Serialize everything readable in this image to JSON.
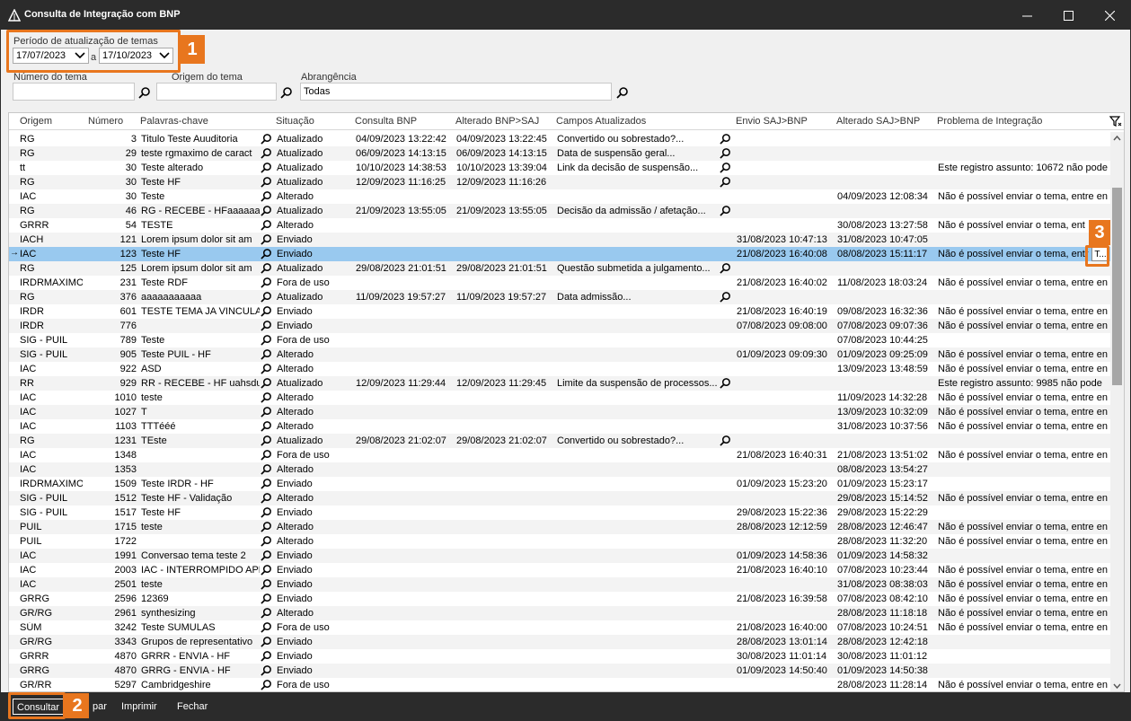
{
  "window": {
    "title": "Consulta de Integração com BNP"
  },
  "filters": {
    "period_label": "Período de atualização de temas",
    "date_from": "17/07/2023",
    "date_sep": "a",
    "date_to": "17/10/2023",
    "numero_label": "Número do tema",
    "numero_value": "",
    "origem_label": "Origem do tema",
    "origem_value": "",
    "abrangencia_label": "Abrangência",
    "abrangencia_value": "Todas"
  },
  "callouts": {
    "c1": "1",
    "c2": "2",
    "c3": "3"
  },
  "grid": {
    "columns": [
      "Origem",
      "Número",
      "Palavras-chave",
      "Situação",
      "Consulta BNP",
      "Alterado BNP>SAJ",
      "Campos Atualizados",
      "Envio SAJ>BNP",
      "Alterado SAJ>BNP",
      "Problema de Integração"
    ],
    "ellipsis_label": "T...",
    "rows": [
      {
        "o": "RG",
        "n": "3",
        "p": "Titulo Teste Auuditoria",
        "s": "Atualizado",
        "c": "04/09/2023 13:22:42",
        "a": "04/09/2023 13:22:45",
        "f": "Convertido ou sobrestado?...",
        "e": "",
        "x": "",
        "pr": ""
      },
      {
        "o": "RG",
        "n": "29",
        "p": "teste rgmaximo de caract",
        "s": "Atualizado",
        "c": "06/09/2023 14:13:15",
        "a": "06/09/2023 14:13:15",
        "f": "Data de suspensão geral...",
        "e": "",
        "x": "",
        "pr": ""
      },
      {
        "o": "tt",
        "n": "30",
        "p": "Teste alterado",
        "s": "Atualizado",
        "c": "10/10/2023 14:38:53",
        "a": "10/10/2023 13:39:04",
        "f": "Link da decisão de suspensão...",
        "e": "",
        "x": "",
        "pr": "Este registro assunto: 10672 não pode"
      },
      {
        "o": "RG",
        "n": "30",
        "p": "Teste HF",
        "s": "Atualizado",
        "c": "12/09/2023 11:16:25",
        "a": "12/09/2023 11:16:26",
        "f": "",
        "e": "",
        "x": "",
        "pr": ""
      },
      {
        "o": "IAC",
        "n": "30",
        "p": "Teste",
        "s": "Alterado",
        "c": "",
        "a": "",
        "f": "",
        "e": "",
        "x": "04/09/2023 12:08:34",
        "pr": "Não é possível enviar o tema, entre en"
      },
      {
        "o": "RG",
        "n": "46",
        "p": "RG - RECEBE - HFaaaaaaa",
        "s": "Atualizado",
        "c": "21/09/2023 13:55:05",
        "a": "21/09/2023 13:55:05",
        "f": "Decisão da admissão / afetação...",
        "e": "",
        "x": "",
        "pr": ""
      },
      {
        "o": "GRRR",
        "n": "54",
        "p": "TESTE",
        "s": "Alterado",
        "c": "",
        "a": "",
        "f": "",
        "e": "",
        "x": "30/08/2023 13:27:58",
        "pr": "Não é possível enviar o tema, ent"
      },
      {
        "o": "IACH",
        "n": "121",
        "p": "Lorem ipsum dolor sit am",
        "s": "Enviado",
        "c": "",
        "a": "",
        "f": "",
        "e": "31/08/2023 10:47:13",
        "x": "31/08/2023 10:47:05",
        "pr": ""
      },
      {
        "o": "IAC",
        "n": "123",
        "p": "Teste HF",
        "s": "Enviado",
        "c": "",
        "a": "",
        "f": "",
        "e": "21/08/2023 16:40:08",
        "x": "08/08/2023 15:11:17",
        "pr": "Não é possível enviar o tema, entr"
      },
      {
        "o": "RG",
        "n": "125",
        "p": "Lorem ipsum dolor sit am",
        "s": "Atualizado",
        "c": "29/08/2023 21:01:51",
        "a": "29/08/2023 21:01:51",
        "f": "Questão submetida a julgamento...",
        "e": "",
        "x": "",
        "pr": ""
      },
      {
        "o": "IRDRMAXIMO",
        "n": "231",
        "p": "Teste RDF",
        "s": "Fora de uso",
        "c": "",
        "a": "",
        "f": "",
        "e": "21/08/2023 16:40:02",
        "x": "11/08/2023 18:03:24",
        "pr": "Não é possível enviar o tema, entre en"
      },
      {
        "o": "RG",
        "n": "376",
        "p": "aaaaaaaaaaa",
        "s": "Atualizado",
        "c": "11/09/2023 19:57:27",
        "a": "11/09/2023 19:57:27",
        "f": "Data admissão...",
        "e": "",
        "x": "",
        "pr": ""
      },
      {
        "o": "IRDR",
        "n": "601",
        "p": "TESTE TEMA JA VINCULAD",
        "s": "Enviado",
        "c": "",
        "a": "",
        "f": "",
        "e": "21/08/2023 16:40:19",
        "x": "09/08/2023 16:32:36",
        "pr": "Não é possível enviar o tema, entre en"
      },
      {
        "o": "IRDR",
        "n": "776",
        "p": "",
        "s": "Enviado",
        "c": "",
        "a": "",
        "f": "",
        "e": "07/08/2023 09:08:00",
        "x": "07/08/2023 09:07:36",
        "pr": "Não é possível enviar o tema, entre en"
      },
      {
        "o": "SIG - PUIL",
        "n": "789",
        "p": "Teste",
        "s": "Fora de uso",
        "c": "",
        "a": "",
        "f": "",
        "e": "",
        "x": "07/08/2023 10:44:25",
        "pr": ""
      },
      {
        "o": "SIG - PUIL",
        "n": "905",
        "p": "Teste PUIL - HF",
        "s": "Alterado",
        "c": "",
        "a": "",
        "f": "",
        "e": "01/09/2023 09:09:30",
        "x": "01/09/2023 09:25:09",
        "pr": "Não é possível enviar o tema, entre en"
      },
      {
        "o": "IAC",
        "n": "922",
        "p": "ASD",
        "s": "Alterado",
        "c": "",
        "a": "",
        "f": "",
        "e": "",
        "x": "13/09/2023 13:48:59",
        "pr": "Não é possível enviar o tema, entre en"
      },
      {
        "o": "RR",
        "n": "929",
        "p": "RR - RECEBE - HF uahsdus",
        "s": "Atualizado",
        "c": "12/09/2023 11:29:44",
        "a": "12/09/2023 11:29:45",
        "f": "Limite da suspensão de processos...",
        "e": "",
        "x": "",
        "pr": "Este registro assunto: 9985 não pode"
      },
      {
        "o": "IAC",
        "n": "1010",
        "p": "teste",
        "s": "Alterado",
        "c": "",
        "a": "",
        "f": "",
        "e": "",
        "x": "11/09/2023 14:32:28",
        "pr": "Não é possível enviar o tema, entre en"
      },
      {
        "o": "IAC",
        "n": "1027",
        "p": "T",
        "s": "Alterado",
        "c": "",
        "a": "",
        "f": "",
        "e": "",
        "x": "13/09/2023 10:32:09",
        "pr": "Não é possível enviar o tema, entre en"
      },
      {
        "o": "IAC",
        "n": "1103",
        "p": "TTTééé",
        "s": "Alterado",
        "c": "",
        "a": "",
        "f": "",
        "e": "",
        "x": "31/08/2023 10:37:56",
        "pr": "Não é possível enviar o tema, entre en"
      },
      {
        "o": "RG",
        "n": "1231",
        "p": "TEste",
        "s": "Atualizado",
        "c": "29/08/2023 21:02:07",
        "a": "29/08/2023 21:02:07",
        "f": "Convertido ou sobrestado?...",
        "e": "",
        "x": "",
        "pr": ""
      },
      {
        "o": "IAC",
        "n": "1348",
        "p": "",
        "s": "Fora de uso",
        "c": "",
        "a": "",
        "f": "",
        "e": "21/08/2023 16:40:31",
        "x": "21/08/2023 13:51:02",
        "pr": "Não é possível enviar o tema, entre en"
      },
      {
        "o": "IAC",
        "n": "1353",
        "p": "",
        "s": "Alterado",
        "c": "",
        "a": "",
        "f": "",
        "e": "",
        "x": "08/08/2023 13:54:27",
        "pr": ""
      },
      {
        "o": "IRDRMAXIMO",
        "n": "1509",
        "p": "Teste IRDR - HF",
        "s": "Enviado",
        "c": "",
        "a": "",
        "f": "",
        "e": "01/09/2023 15:23:20",
        "x": "01/09/2023 15:23:17",
        "pr": ""
      },
      {
        "o": "SIG - PUIL",
        "n": "1512",
        "p": "Teste HF - Validação",
        "s": "Alterado",
        "c": "",
        "a": "",
        "f": "",
        "e": "",
        "x": "29/08/2023 15:14:52",
        "pr": "Não é possível enviar o tema, entre en"
      },
      {
        "o": "SIG - PUIL",
        "n": "1517",
        "p": "Teste HF",
        "s": "Enviado",
        "c": "",
        "a": "",
        "f": "",
        "e": "29/08/2023 15:22:36",
        "x": "29/08/2023 15:22:29",
        "pr": ""
      },
      {
        "o": "PUIL",
        "n": "1715",
        "p": "teste",
        "s": "Alterado",
        "c": "",
        "a": "",
        "f": "",
        "e": "28/08/2023 12:12:59",
        "x": "28/08/2023 12:46:47",
        "pr": "Não é possível enviar o tema, entre en"
      },
      {
        "o": "PUIL",
        "n": "1722",
        "p": "",
        "s": "Alterado",
        "c": "",
        "a": "",
        "f": "",
        "e": "",
        "x": "28/08/2023 11:32:20",
        "pr": "Não é possível enviar o tema, entre en"
      },
      {
        "o": "IAC",
        "n": "1991",
        "p": "Conversao tema teste 2",
        "s": "Enviado",
        "c": "",
        "a": "",
        "f": "",
        "e": "01/09/2023 14:58:36",
        "x": "01/09/2023 14:58:32",
        "pr": ""
      },
      {
        "o": "IAC",
        "n": "2003",
        "p": "IAC - INTERROMPIDO APE",
        "s": "Enviado",
        "c": "",
        "a": "",
        "f": "",
        "e": "21/08/2023 16:40:10",
        "x": "07/08/2023 10:23:44",
        "pr": "Não é possível enviar o tema, entre en"
      },
      {
        "o": "IAC",
        "n": "2501",
        "p": "teste",
        "s": "Enviado",
        "c": "",
        "a": "",
        "f": "",
        "e": "",
        "x": "31/08/2023 08:38:03",
        "pr": "Não é possível enviar o tema, entre en"
      },
      {
        "o": "GRRG",
        "n": "2596",
        "p": "12369",
        "s": "Enviado",
        "c": "",
        "a": "",
        "f": "",
        "e": "21/08/2023 16:39:58",
        "x": "07/08/2023 08:42:10",
        "pr": "Não é possível enviar o tema, entre en"
      },
      {
        "o": "GR/RG",
        "n": "2961",
        "p": "synthesizing",
        "s": "Alterado",
        "c": "",
        "a": "",
        "f": "",
        "e": "",
        "x": "28/08/2023 11:18:18",
        "pr": "Não é possível enviar o tema, entre en"
      },
      {
        "o": "SÚM",
        "n": "3242",
        "p": "Teste SUMULAS",
        "s": "Fora de uso",
        "c": "",
        "a": "",
        "f": "",
        "e": "21/08/2023 16:40:00",
        "x": "07/08/2023 10:24:51",
        "pr": "Não é possível enviar o tema, entre en"
      },
      {
        "o": "GR/RG",
        "n": "3343",
        "p": "Grupos de representativo",
        "s": "Enviado",
        "c": "",
        "a": "",
        "f": "",
        "e": "28/08/2023 13:01:14",
        "x": "28/08/2023 12:42:18",
        "pr": ""
      },
      {
        "o": "GRRR",
        "n": "4870",
        "p": "GRRR - ENVIA - HF",
        "s": "Enviado",
        "c": "",
        "a": "",
        "f": "",
        "e": "30/08/2023 11:01:14",
        "x": "30/08/2023 11:01:12",
        "pr": ""
      },
      {
        "o": "GRRG",
        "n": "4870",
        "p": "GRRG - ENVIA - HF",
        "s": "Enviado",
        "c": "",
        "a": "",
        "f": "",
        "e": "01/09/2023 14:50:40",
        "x": "01/09/2023 14:50:38",
        "pr": ""
      },
      {
        "o": "GR/RR",
        "n": "5297",
        "p": "Cambridgeshire",
        "s": "Fora de uso",
        "c": "",
        "a": "",
        "f": "",
        "e": "",
        "x": "28/08/2023 11:28:14",
        "pr": "Não é possível enviar o tema, entre en"
      }
    ]
  },
  "bottombar": {
    "consultar": "Consultar",
    "limpar": "par",
    "imprimir": "Imprimir",
    "fechar": "Fechar"
  }
}
